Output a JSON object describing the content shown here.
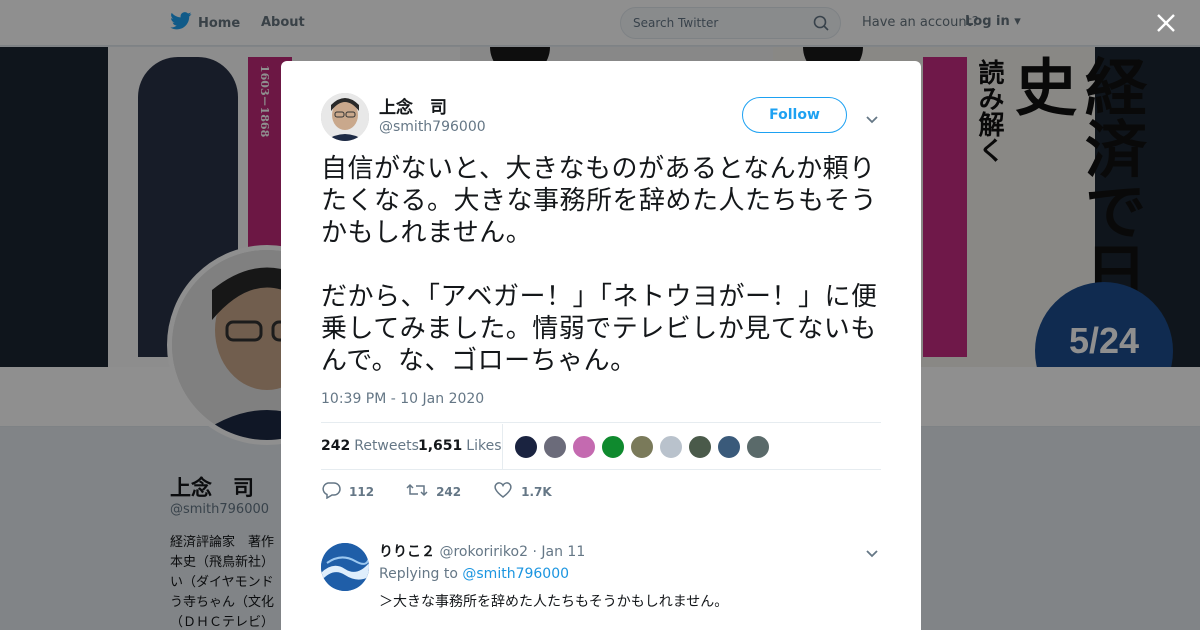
{
  "nav": {
    "home_label": "Home",
    "about_label": "About",
    "search_placeholder": "Search Twitter",
    "have_account": "Have an account?",
    "login_label": "Log in"
  },
  "profile": {
    "name": "上念　司",
    "handle": "@smith796000",
    "bio": "経済評論家　著作\n本史（飛鳥新社）\nい（ダイヤモンド\nう寺ちゃん（文化\n（ＤＨＣテレビ）"
  },
  "banner": {
    "book1_years": "1603－1868",
    "book3_sub": "読み解く",
    "book3_title": "経済で日本史",
    "date_badge": "5/24"
  },
  "tweet": {
    "name": "上念　司",
    "handle": "@smith796000",
    "follow_label": "Follow",
    "text": "自信がないと、大きなものがあるとなんか頼りたくなる。大きな事務所を辞めた人たちもそうかもしれません。\n\nだから、「アベガー！」「ネトウヨがー！」に便乗してみました。情弱でテレビしか見てないもんで。な、ゴローちゃん。",
    "timestamp": "10:39 PM - 10 Jan 2020",
    "retweets_count": "242",
    "retweets_label": "Retweets",
    "likes_count": "1,651",
    "likes_label": "Likes",
    "likers": [
      "#1a2340",
      "#6b6b7a",
      "#c46ab0",
      "#0f8a2e",
      "#7a7a5a",
      "#b9c2cc",
      "#4a5a4a",
      "#3a5a7a",
      "#5a6a6a"
    ],
    "actions": {
      "reply_count": "112",
      "retweet_count": "242",
      "like_count": "1.7K"
    }
  },
  "reply": {
    "name": "りりこ２",
    "handle": "@rokoririko2",
    "dot": "·",
    "date": "Jan 11",
    "replying_prefix": "Replying to",
    "replying_to": "@smith796000",
    "text": "＞大きな事務所を辞めた人たちもそうかもしれません。"
  },
  "colors": {
    "accent": "#1da1f2",
    "twitter_blue": "#1da1f2"
  }
}
